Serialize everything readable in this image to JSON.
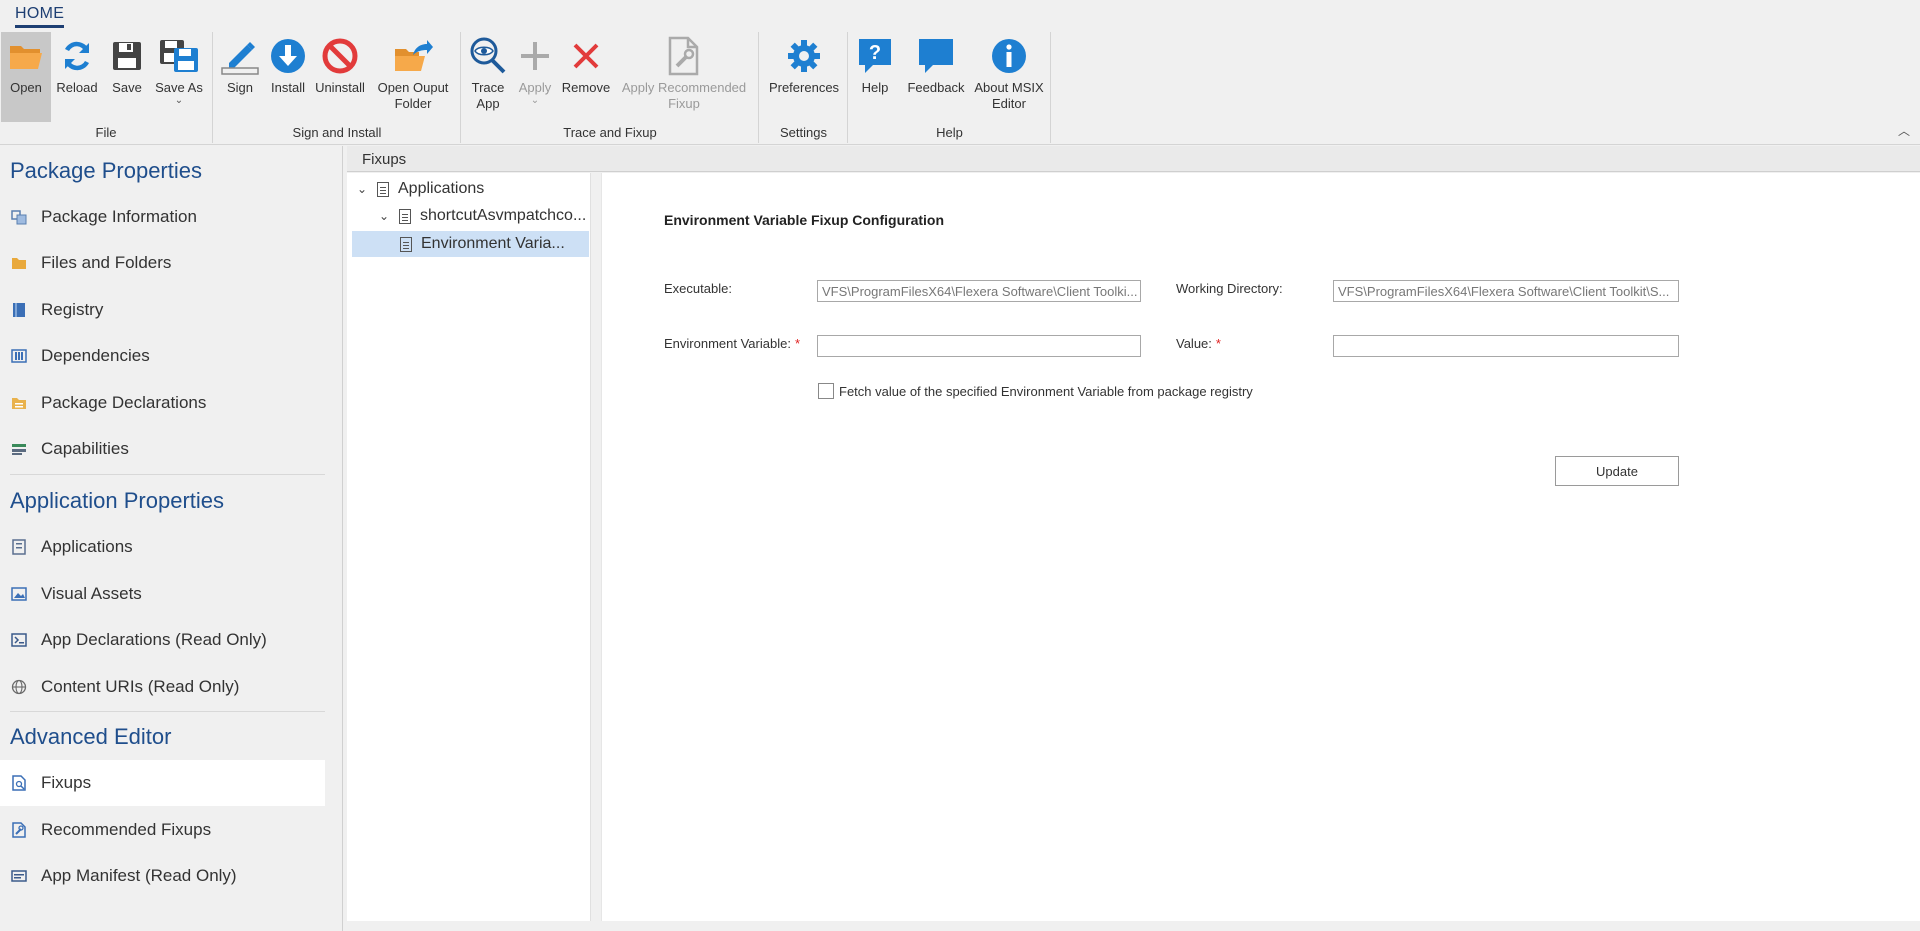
{
  "tabs": {
    "home": "HOME"
  },
  "ribbon": {
    "file": {
      "label": "File",
      "open": "Open",
      "reload": "Reload",
      "save": "Save",
      "save_as": "Save As"
    },
    "sign_install": {
      "label": "Sign and Install",
      "sign": "Sign",
      "install": "Install",
      "uninstall": "Uninstall",
      "open_output_1": "Open Ouput",
      "open_output_2": "Folder"
    },
    "trace_fixup": {
      "label": "Trace and Fixup",
      "trace_1": "Trace",
      "trace_2": "App",
      "apply": "Apply",
      "remove": "Remove",
      "apply_rec_1": "Apply Recommended",
      "apply_rec_2": "Fixup"
    },
    "settings": {
      "label": "Settings",
      "preferences": "Preferences"
    },
    "help": {
      "label": "Help",
      "help": "Help",
      "feedback": "Feedback",
      "about_1": "About MSIX",
      "about_2": "Editor"
    }
  },
  "nav": {
    "package_properties": "Package Properties",
    "package_information": "Package Information",
    "files_and_folders": "Files and Folders",
    "registry": "Registry",
    "dependencies": "Dependencies",
    "package_declarations": "Package Declarations",
    "capabilities": "Capabilities",
    "application_properties": "Application Properties",
    "applications": "Applications",
    "visual_assets": "Visual Assets",
    "app_declarations": "App Declarations (Read Only)",
    "content_uris": "Content URIs (Read Only)",
    "advanced_editor": "Advanced Editor",
    "fixups": "Fixups",
    "recommended_fixups": "Recommended Fixups",
    "app_manifest": "App Manifest (Read Only)"
  },
  "content": {
    "header": "Fixups",
    "tree": {
      "root": "Applications",
      "child": "shortcutAsvmpatchco...",
      "leaf": "Environment Varia..."
    },
    "form": {
      "title": "Environment Variable Fixup Configuration",
      "executable_label": "Executable:",
      "executable_value": "VFS\\ProgramFilesX64\\Flexera Software\\Client Toolki...",
      "working_dir_label": "Working Directory:",
      "working_dir_value": "VFS\\ProgramFilesX64\\Flexera Software\\Client Toolkit\\S...",
      "env_var_label": "Environment Variable:",
      "value_label": "Value:",
      "required_mark": "*",
      "env_var_value": "",
      "value_value": "",
      "fetch_checkbox_label": "Fetch value of the specified Environment Variable from package registry",
      "update_button": "Update"
    }
  },
  "colors": {
    "accent": "#1f4e8c",
    "icon_blue": "#1e7fd1",
    "icon_red": "#e23b3b",
    "icon_orange": "#f0a23c",
    "required": "#e02020"
  }
}
